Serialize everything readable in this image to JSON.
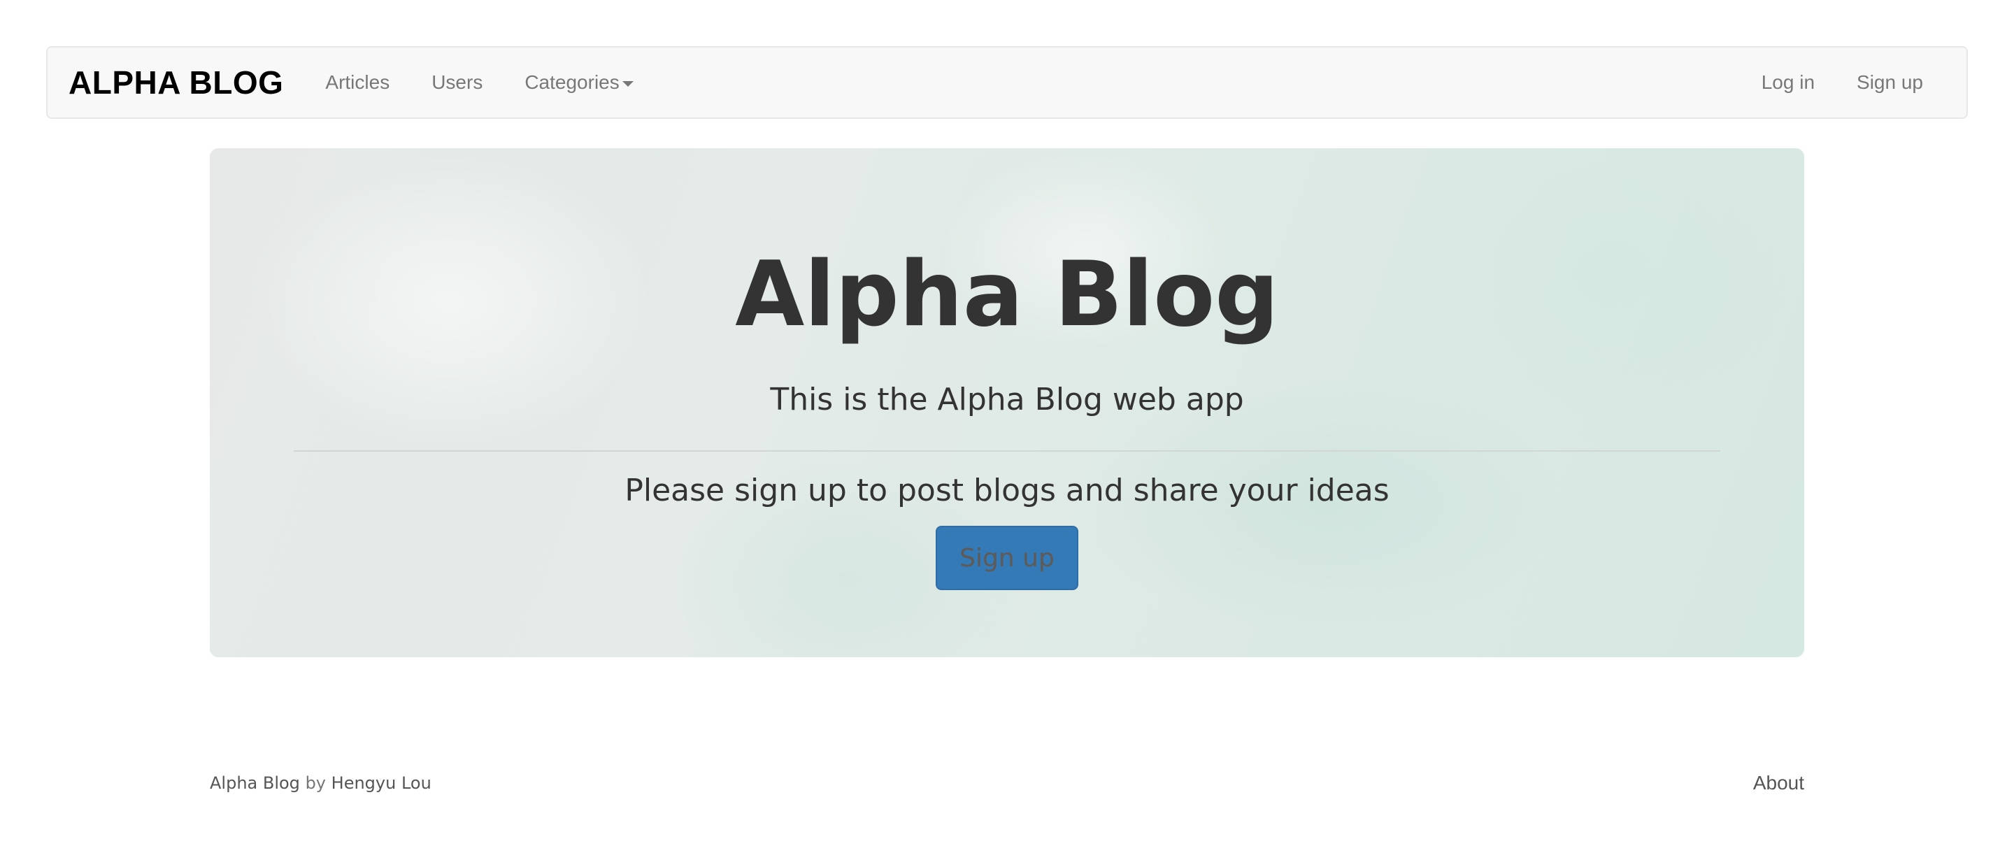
{
  "navbar": {
    "brand": "ALPHA BLOG",
    "left_links": {
      "articles": "Articles",
      "users": "Users",
      "categories": "Categories"
    },
    "right_links": {
      "login": "Log in",
      "signup": "Sign up"
    }
  },
  "jumbotron": {
    "title": "Alpha Blog",
    "subtitle": "This is the Alpha Blog web app",
    "cta_text": "Please sign up to post blogs and share your ideas",
    "signup_button": "Sign up"
  },
  "footer": {
    "app_name": "Alpha Blog",
    "by": "by",
    "author": "Hengyu Lou",
    "about": "About"
  },
  "colors": {
    "primary_button": "#337ab7",
    "navbar_bg": "#f8f8f8",
    "text": "#333333"
  },
  "icons": {
    "categories_dropdown": "caret-down-icon"
  }
}
